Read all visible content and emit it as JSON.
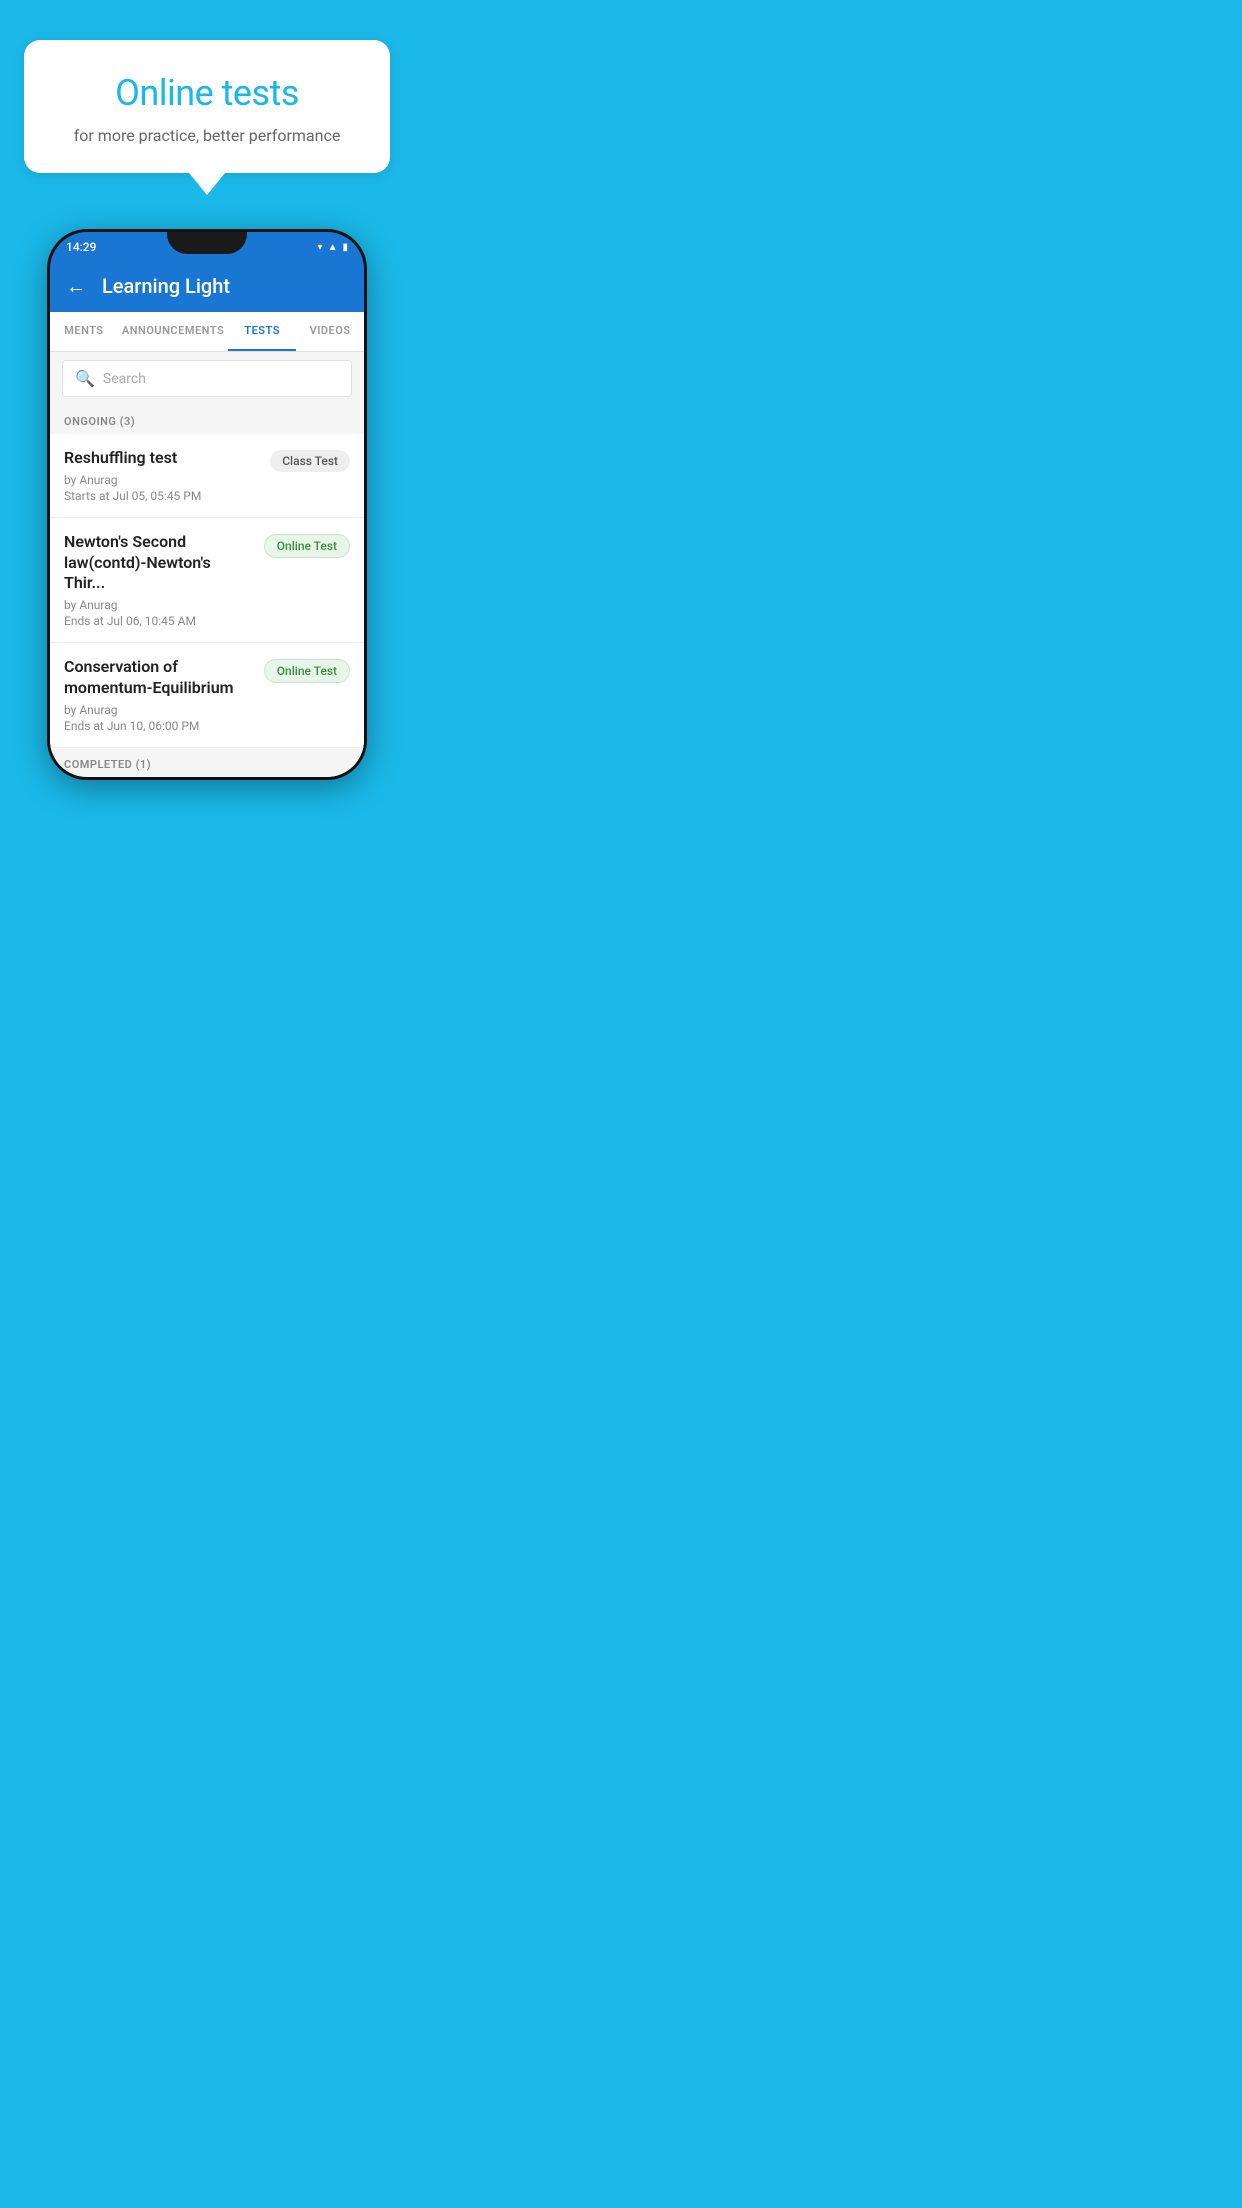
{
  "background_color": "#1ab8e8",
  "speech_bubble": {
    "title": "Online tests",
    "subtitle": "for more practice, better performance"
  },
  "phone": {
    "status_bar": {
      "time": "14:29",
      "icons": [
        "wifi",
        "signal",
        "battery"
      ]
    },
    "app_bar": {
      "title": "Learning Light",
      "back_label": "←"
    },
    "tabs": [
      {
        "label": "MENTS",
        "active": false
      },
      {
        "label": "ANNOUNCEMENTS",
        "active": false
      },
      {
        "label": "TESTS",
        "active": true
      },
      {
        "label": "VIDEOS",
        "active": false
      }
    ],
    "search": {
      "placeholder": "Search"
    },
    "section_label": "ONGOING (3)",
    "tests": [
      {
        "title": "Reshuffling test",
        "by": "by Anurag",
        "time_label": "Starts at  Jul 05, 05:45 PM",
        "badge": "Class Test",
        "badge_type": "class"
      },
      {
        "title": "Newton's Second law(contd)-Newton's Thir...",
        "by": "by Anurag",
        "time_label": "Ends at  Jul 06, 10:45 AM",
        "badge": "Online Test",
        "badge_type": "online"
      },
      {
        "title": "Conservation of momentum-Equilibrium",
        "by": "by Anurag",
        "time_label": "Ends at  Jun 10, 06:00 PM",
        "badge": "Online Test",
        "badge_type": "online"
      }
    ],
    "completed_label": "COMPLETED (1)"
  }
}
